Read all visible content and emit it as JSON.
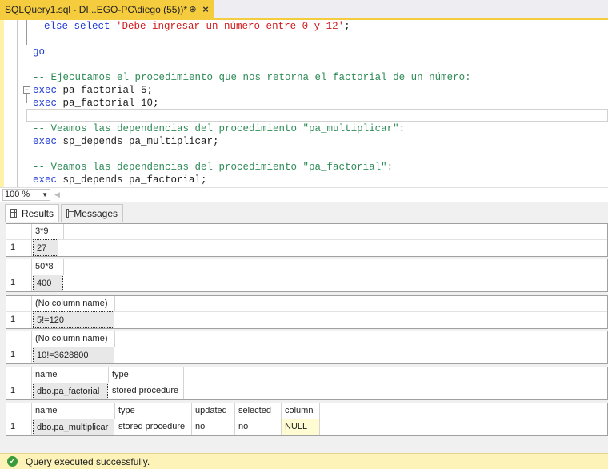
{
  "tab": {
    "title": "SQLQuery1.sql - DI...EGO-PC\\diego (55))*",
    "pin_glyph": "⊕",
    "close_glyph": "×"
  },
  "editor": {
    "line1": {
      "kw": "else select",
      "str": "'Debe ingresar un número entre 0 y 12'",
      "tail": ";"
    },
    "line2": {
      "kw": "go"
    },
    "line3": {
      "cm": "-- Ejecutamos el procedimiento que nos retorna el factorial de un número:"
    },
    "line4": {
      "kw": "exec",
      "tx": " pa_factorial 5;"
    },
    "line5": {
      "kw": "exec",
      "tx": " pa_factorial 10;"
    },
    "line6": {
      "cm": "-- Veamos las dependencias del procedimiento \"pa_multiplicar\":"
    },
    "line7": {
      "kw": "exec",
      "tx": " sp_depends pa_multiplicar;"
    },
    "line8": {
      "cm": "-- Veamos las dependencias del procedimiento \"pa_factorial\":"
    },
    "line9": {
      "kw": "exec",
      "tx": " sp_depends pa_factorial;"
    },
    "fold_glyph": "−"
  },
  "zoom": {
    "value": "100 %"
  },
  "result_tabs": {
    "results": "Results",
    "messages": "Messages"
  },
  "grids": [
    {
      "headers": [
        "3*9"
      ],
      "row": "1",
      "cells": [
        "27"
      ]
    },
    {
      "headers": [
        "50*8"
      ],
      "row": "1",
      "cells": [
        "400"
      ]
    },
    {
      "headers": [
        "(No column name)"
      ],
      "row": "1",
      "cells": [
        "5!=120"
      ]
    },
    {
      "headers": [
        "(No column name)"
      ],
      "row": "1",
      "cells": [
        "10!=3628800"
      ]
    },
    {
      "headers": [
        "name",
        "type"
      ],
      "row": "1",
      "cells": [
        "dbo.pa_factorial",
        "stored procedure"
      ]
    },
    {
      "headers": [
        "name",
        "type",
        "updated",
        "selected",
        "column"
      ],
      "row": "1",
      "cells": [
        "dbo.pa_multiplicar",
        "stored procedure",
        "no",
        "no",
        "NULL"
      ]
    }
  ],
  "status": {
    "text": "Query executed successfully.",
    "icon": "check-circle-icon",
    "check_glyph": "✓"
  },
  "colors": {
    "tab_accent": "#f5cc3e",
    "keyword": "#1f3cd8",
    "string": "#d11a1a",
    "comment": "#2e8b57",
    "status_bg": "#fdf3b9",
    "null_bg": "#fffbd2"
  }
}
